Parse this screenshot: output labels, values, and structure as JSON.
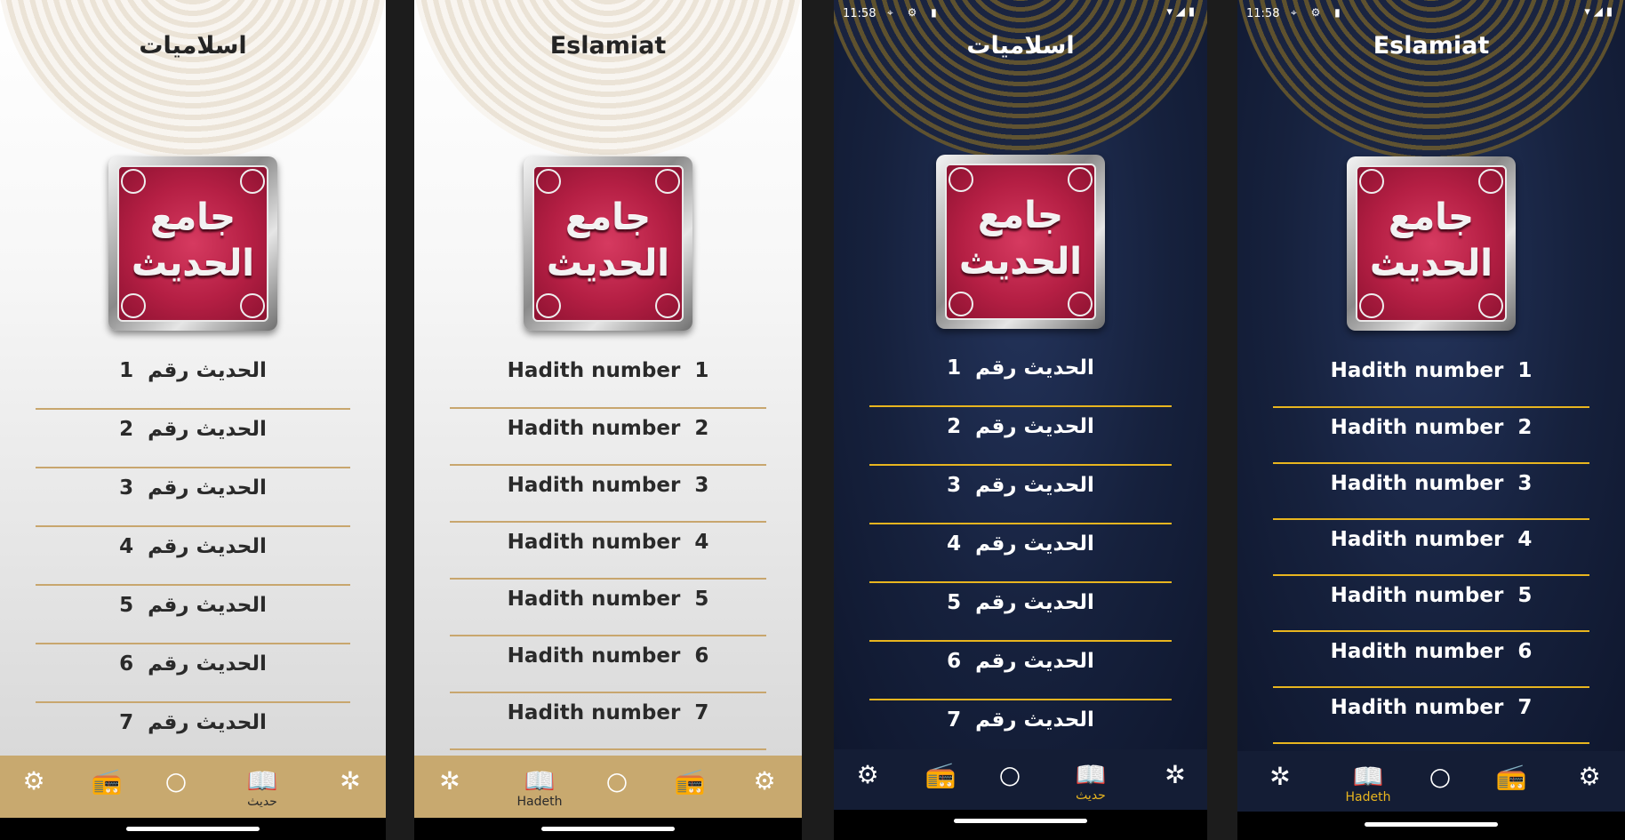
{
  "status": {
    "time": "11:58",
    "left_icons": "⌖ ⚙ ▮",
    "right_icons": "▾◢▮"
  },
  "screens": [
    {
      "theme": "light",
      "title": "اسلاميات",
      "logo_line1": "جامع",
      "logo_line2": "الحديث",
      "rows": [
        {
          "num": "1",
          "text": "الحديث رقم"
        },
        {
          "num": "2",
          "text": "الحديث رقم"
        },
        {
          "num": "3",
          "text": "الحديث رقم"
        },
        {
          "num": "4",
          "text": "الحديث رقم"
        },
        {
          "num": "5",
          "text": "الحديث رقم"
        },
        {
          "num": "6",
          "text": "الحديث رقم"
        },
        {
          "num": "7",
          "text": "الحديث رقم"
        }
      ],
      "nav_active_label": "حديث"
    },
    {
      "theme": "light",
      "title": "Eslamiat",
      "logo_line1": "جامع",
      "logo_line2": "الحديث",
      "rows": [
        {
          "text": "Hadith number",
          "num": "1"
        },
        {
          "text": "Hadith number",
          "num": "2"
        },
        {
          "text": "Hadith number",
          "num": "3"
        },
        {
          "text": "Hadith number",
          "num": "4"
        },
        {
          "text": "Hadith number",
          "num": "5"
        },
        {
          "text": "Hadith number",
          "num": "6"
        },
        {
          "text": "Hadith number",
          "num": "7"
        }
      ],
      "nav_active_label": "Hadeth"
    },
    {
      "theme": "dark",
      "title": "اسلاميات",
      "logo_line1": "جامع",
      "logo_line2": "الحديث",
      "rows": [
        {
          "num": "1",
          "text": "الحديث رقم"
        },
        {
          "num": "2",
          "text": "الحديث رقم"
        },
        {
          "num": "3",
          "text": "الحديث رقم"
        },
        {
          "num": "4",
          "text": "الحديث رقم"
        },
        {
          "num": "5",
          "text": "الحديث رقم"
        },
        {
          "num": "6",
          "text": "الحديث رقم"
        },
        {
          "num": "7",
          "text": "الحديث رقم"
        }
      ],
      "nav_active_label": "حديث"
    },
    {
      "theme": "dark",
      "title": "Eslamiat",
      "logo_line1": "جامع",
      "logo_line2": "الحديث",
      "rows": [
        {
          "text": "Hadith number",
          "num": "1"
        },
        {
          "text": "Hadith number",
          "num": "2"
        },
        {
          "text": "Hadith number",
          "num": "3"
        },
        {
          "text": "Hadith number",
          "num": "4"
        },
        {
          "text": "Hadith number",
          "num": "5"
        },
        {
          "text": "Hadith number",
          "num": "6"
        },
        {
          "text": "Hadith number",
          "num": "7"
        }
      ],
      "nav_active_label": "Hadeth"
    }
  ],
  "colors": {
    "light_accent": "#c8a96f",
    "dark_accent": "#e8b51f",
    "dark_bg": "#16213d",
    "logo_red": "#b51f44"
  },
  "icons": {
    "settings": "gear-icon",
    "radio": "radio-icon",
    "sebha": "sebha-icon",
    "hadeth": "book-icon",
    "quran": "quran-icon"
  }
}
